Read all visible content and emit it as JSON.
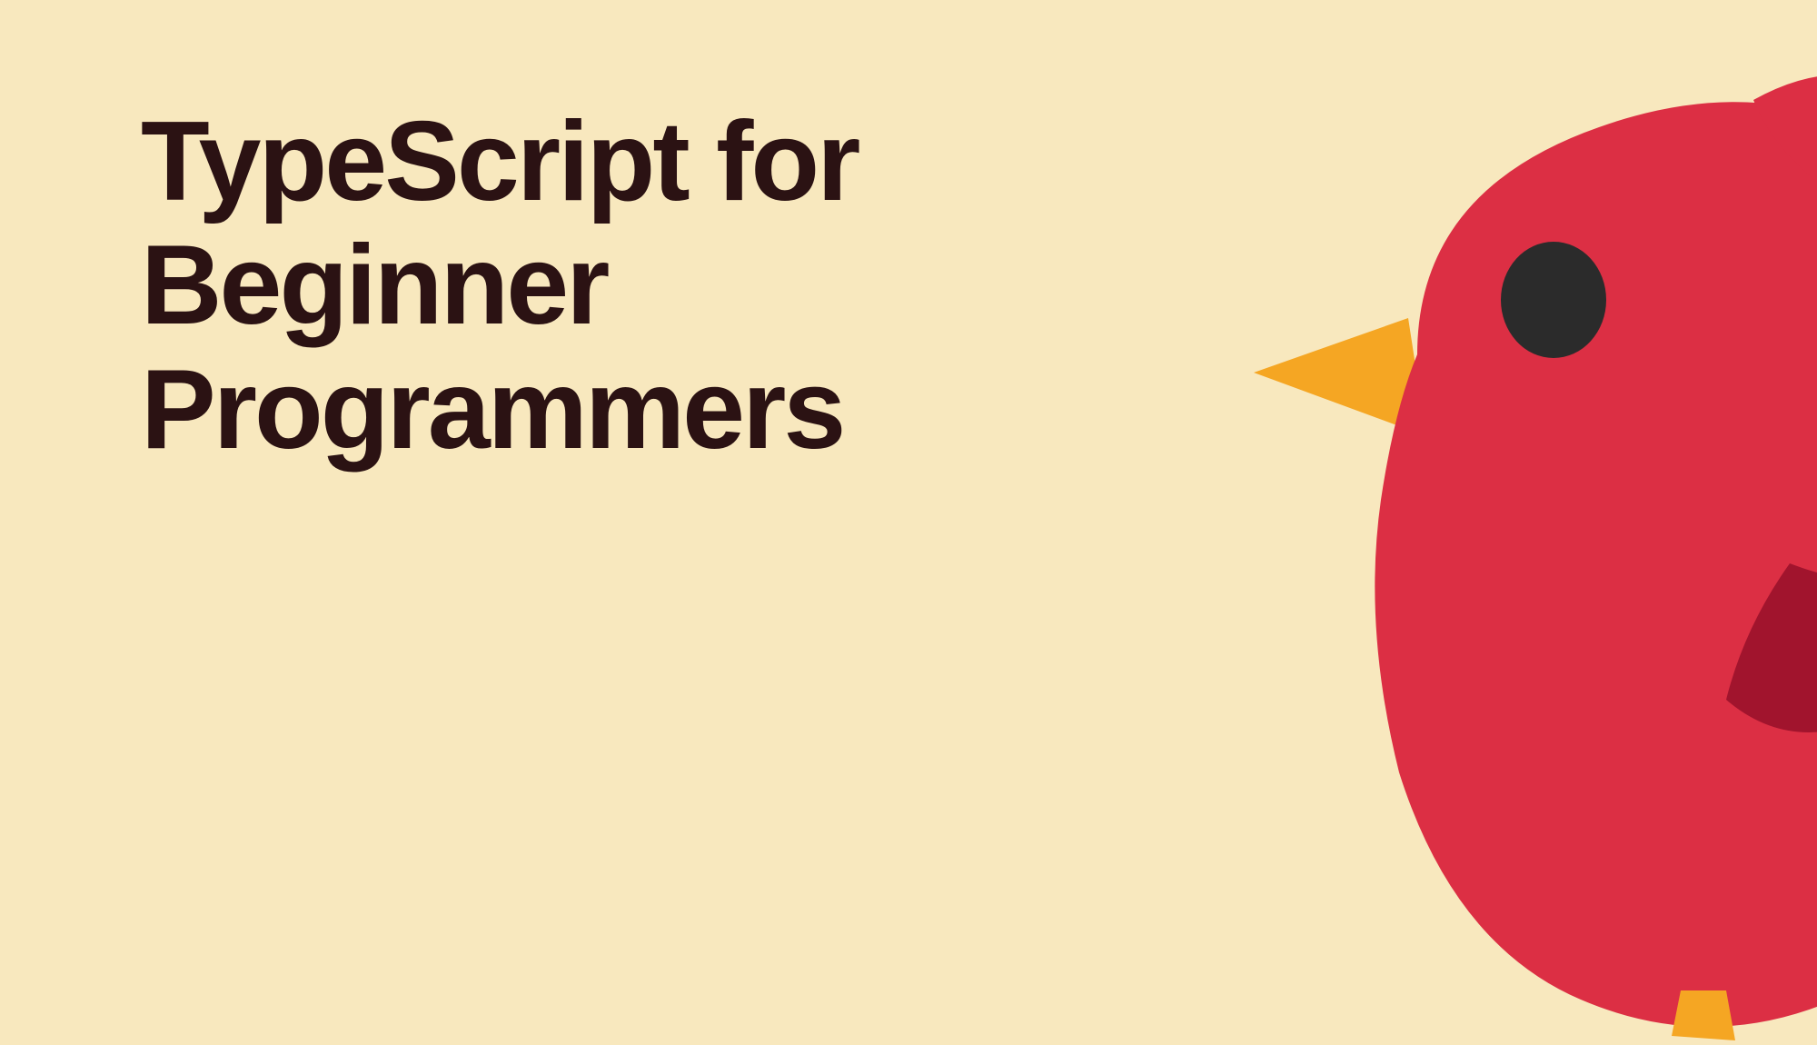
{
  "hero": {
    "title": "TypeScript for\nBeginner\nProgrammers"
  },
  "colors": {
    "background": "#F8E8BE",
    "text": "#2B1213",
    "birdBody": "#DC2F44",
    "birdDark": "#A1142D",
    "beak": "#F5A623",
    "eye": "#2B2B2B"
  }
}
